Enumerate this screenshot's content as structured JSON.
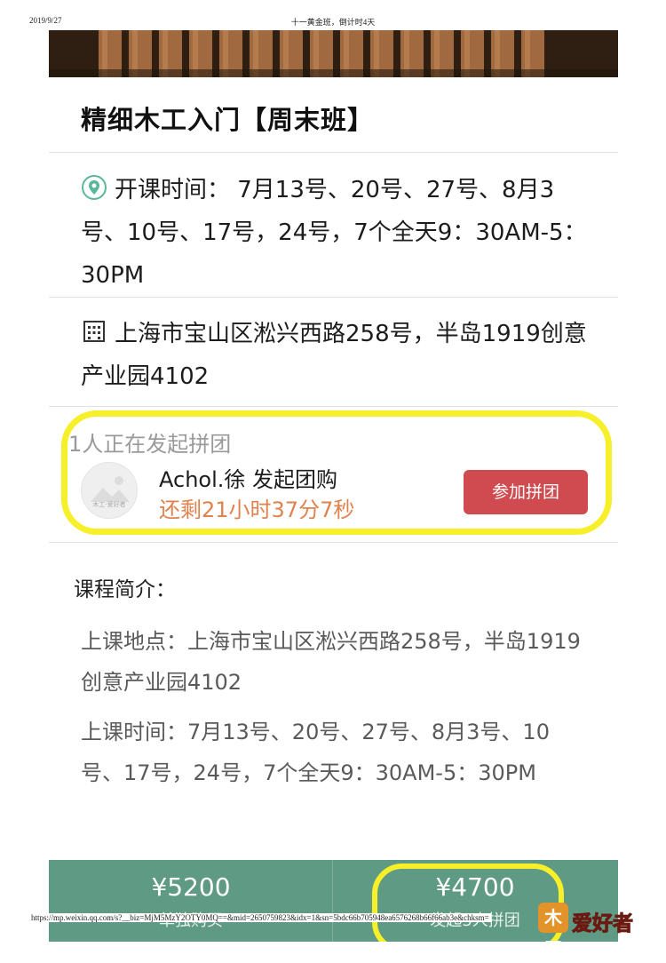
{
  "print_header": {
    "date": "2019/9/27",
    "title": "十一黄金班，倒计时4天"
  },
  "course": {
    "title": "精细木工入门【周末班】",
    "schedule": "开课时间： 7月13号、20号、27号、8月3号、10号、17号，24号，7个全天9：30AM-5：30PM",
    "address": "上海市宝山区淞兴西路258号，半岛1919创意产业园4102"
  },
  "group_buy": {
    "count_text": "1人正在发起拼团",
    "avatar_caption": "木工·爱好者",
    "initiator": "Achol.徐 发起团购",
    "countdown": "还剩21小时37分7秒",
    "join_label": "参加拼团"
  },
  "intro": {
    "heading": "课程简介：",
    "location": "上课地点：上海市宝山区淞兴西路258号，半岛1919创意产业园4102",
    "time": "上课时间：7月13号、20号、27号、8月3号、10号、17号，24号，7个全天9：30AM-5：30PM"
  },
  "footer": {
    "single_price": "¥5200",
    "single_label": "单独购买",
    "group_price": "¥4700",
    "group_label": "发起3人拼团"
  },
  "print_footer": {
    "url": "https://mp.weixin.qq.com/s?__biz=MjM5MzY2OTY0MQ==&mid=2650759823&idx=1&sn=5bdc66b705948ea6576268b66f66ab3e&chksm=",
    "watermark_mark": "木工",
    "watermark_text": "爱好者"
  },
  "colors": {
    "join_button": "#cf4b4f",
    "countdown": "#e0824d",
    "footer_bar": "#5e9a84",
    "highlight": "#f6ef2a",
    "location_icon": "#5ab79a"
  },
  "icons": {
    "schedule": "location-pin-icon",
    "address": "building-icon"
  }
}
